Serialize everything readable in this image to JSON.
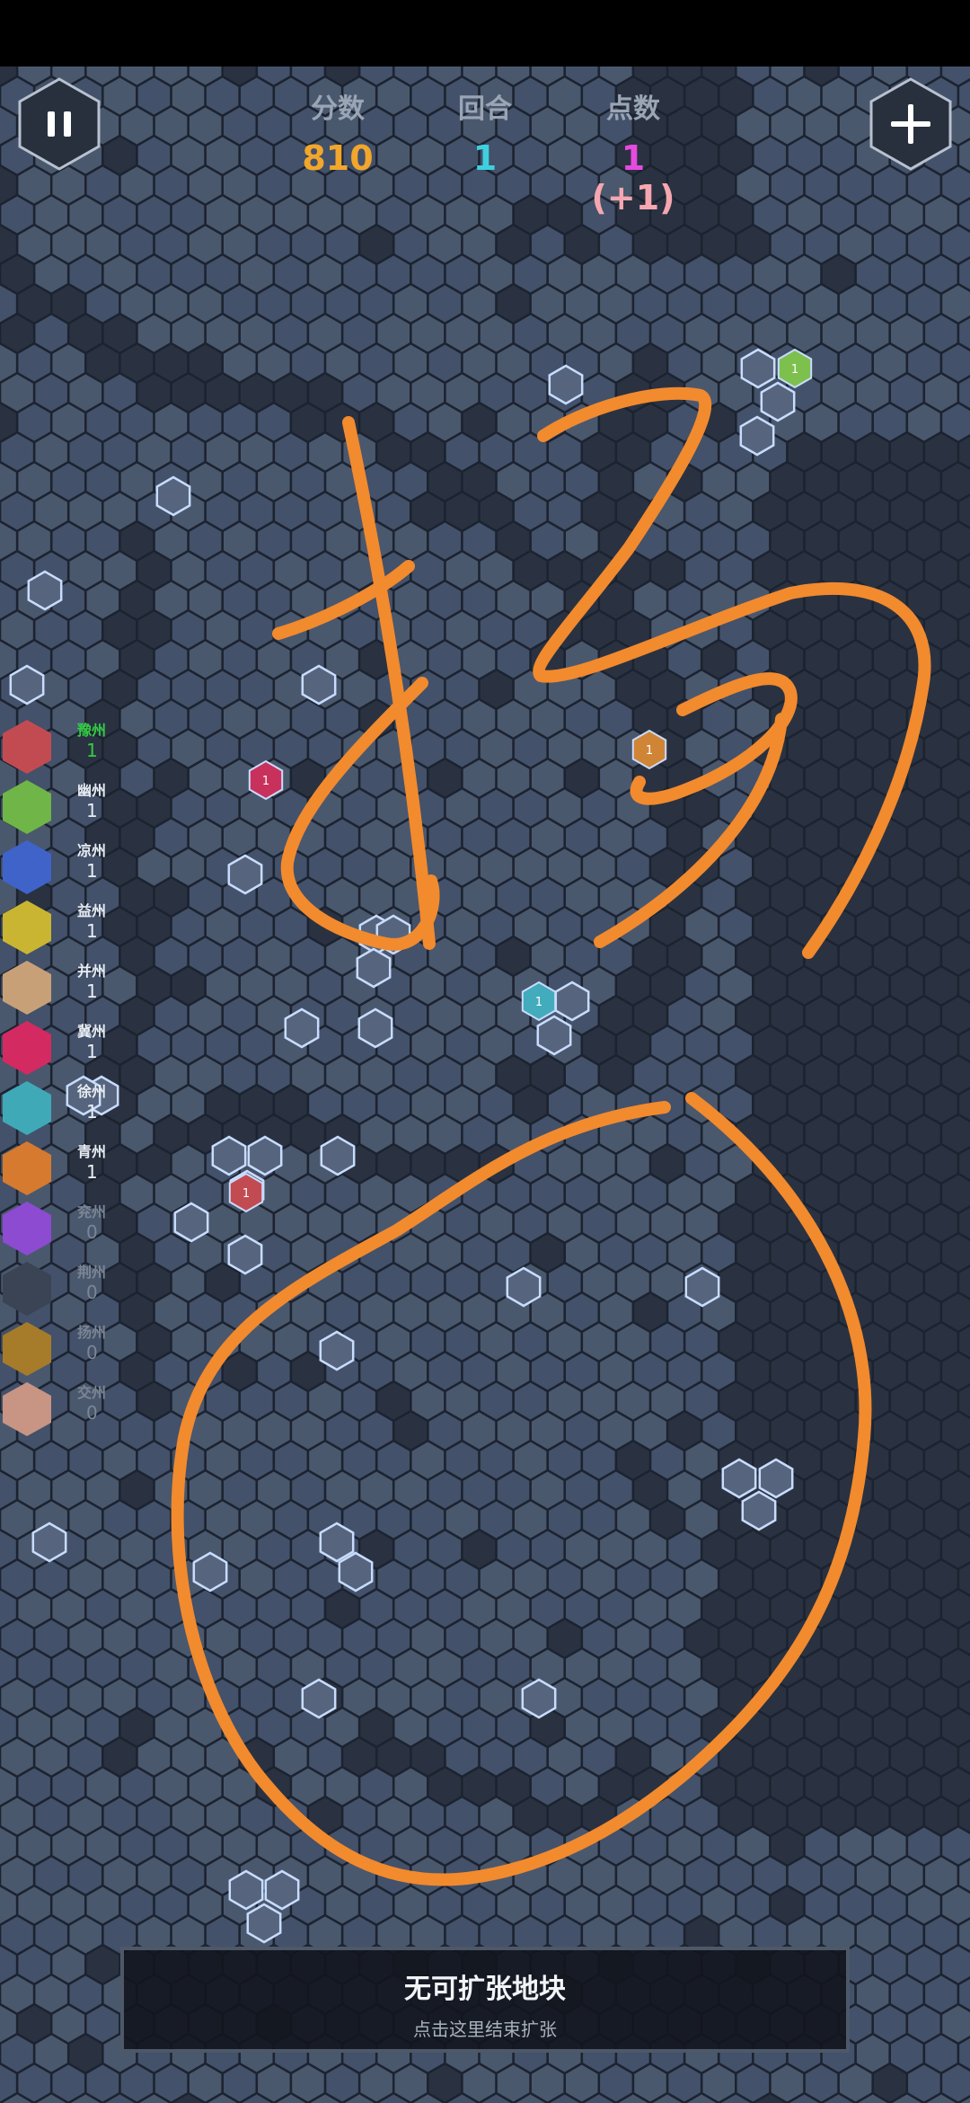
{
  "hud": {
    "score_label": "分数",
    "score_value": "810",
    "round_label": "回合",
    "round_value": "1",
    "points_label": "点数",
    "points_value": "1",
    "points_bonus": "(+1)",
    "colors": {
      "score": "#f2a62c",
      "round": "#3fd0e0",
      "points": "#e64ae0",
      "bonus": "#f5a7b0"
    }
  },
  "buttons": {
    "pause_icon": "pause-icon",
    "add_icon": "plus-icon"
  },
  "legend": [
    {
      "name": "豫州",
      "count": "1",
      "color": "#c24b52",
      "active": true
    },
    {
      "name": "幽州",
      "count": "1",
      "color": "#6fb548"
    },
    {
      "name": "凉州",
      "count": "1",
      "color": "#3f63c9"
    },
    {
      "name": "益州",
      "count": "1",
      "color": "#c9b531"
    },
    {
      "name": "并州",
      "count": "1",
      "color": "#c8a078"
    },
    {
      "name": "冀州",
      "count": "1",
      "color": "#d32a61"
    },
    {
      "name": "徐州",
      "count": "1",
      "color": "#3fa9b8"
    },
    {
      "name": "青州",
      "count": "1",
      "color": "#d67a2f"
    },
    {
      "name": "兖州",
      "count": "0",
      "color": "#8c4bd1",
      "zero": true
    },
    {
      "name": "荆州",
      "count": "0",
      "color": "#3a4454",
      "zero": true
    },
    {
      "name": "扬州",
      "count": "0",
      "color": "#a67c2a",
      "zero": true
    },
    {
      "name": "交州",
      "count": "0",
      "color": "#c89484",
      "zero": true
    }
  ],
  "map_tiles": {
    "owned": [
      {
        "label": "1",
        "color": "#7ec04e"
      },
      {
        "label": "1",
        "color": "#d08536"
      },
      {
        "label": "1",
        "color": "#c8315c"
      },
      {
        "label": "1",
        "color": "#42abbc"
      },
      {
        "label": "1",
        "color": "#c24b52"
      }
    ]
  },
  "bottom_panel": {
    "title": "无可扩张地块",
    "subtitle": "点击这里结束扩张"
  },
  "colors": {
    "background": "#1c2330",
    "tile": "#4a586e",
    "water": "#2a3241",
    "highlight": "#c8dcff",
    "annotation": "#f28a2e"
  }
}
